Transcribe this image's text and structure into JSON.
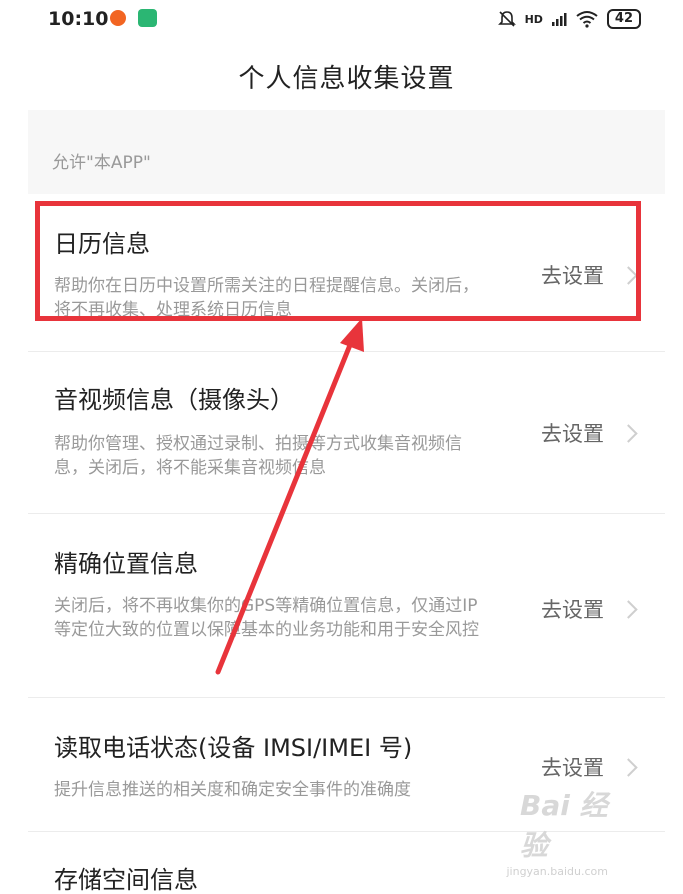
{
  "status_bar": {
    "time": "10:10",
    "network": "HD",
    "battery": "42"
  },
  "header": {
    "title": "个人信息收集设置"
  },
  "section": {
    "label": "允许\"本APP\""
  },
  "items": [
    {
      "title": "日历信息",
      "description": "帮助你在日历中设置所需关注的日程提醒信息。关闭后，将不再收集、处理系统日历信息",
      "action": "去设置"
    },
    {
      "title": "音视频信息（摄像头）",
      "description": "帮助你管理、授权通过录制、拍摄等方式收集音视频信息，关闭后，将不能采集音视频信息",
      "action": "去设置"
    },
    {
      "title": "精确位置信息",
      "description": "关闭后，将不再收集你的GPS等精确位置信息，仅通过IP等定位大致的位置以保障基本的业务功能和用于安全风控",
      "action": "去设置"
    },
    {
      "title": "读取电话状态(设备 IMSI/IMEI 号)",
      "description": "提升信息推送的相关度和确定安全事件的准确度",
      "action": "去设置"
    },
    {
      "title": "存储空间信息"
    }
  ],
  "watermark": {
    "text": "Bai 经验",
    "url": "jingyan.baidu.com"
  },
  "colors": {
    "highlight": "#e8343b",
    "title_text": "#222222",
    "secondary_text": "#999999"
  }
}
